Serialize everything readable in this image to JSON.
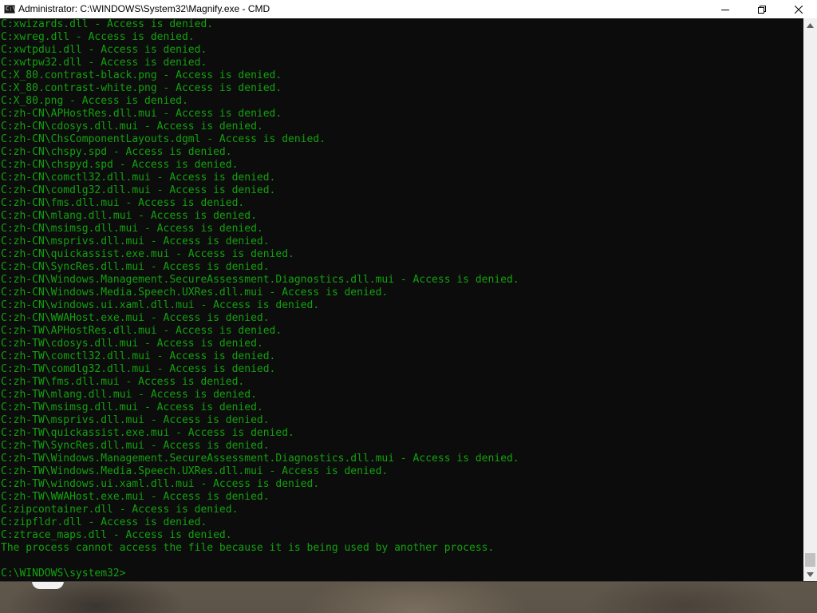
{
  "window": {
    "title": "Administrator: C:\\WINDOWS\\System32\\Magnify.exe - CMD",
    "icon": "cmd-icon",
    "icon_text": "C:\\",
    "controls": {
      "minimize": "minimize-icon",
      "maximize": "maximize-icon",
      "close": "close-icon"
    }
  },
  "console": {
    "text_color": "#13a10e",
    "background": "#0c0c0c",
    "lines": [
      "C:xwizards.dll - Access is denied.",
      "C:xwreg.dll - Access is denied.",
      "C:xwtpdui.dll - Access is denied.",
      "C:xwtpw32.dll - Access is denied.",
      "C:X_80.contrast-black.png - Access is denied.",
      "C:X_80.contrast-white.png - Access is denied.",
      "C:X_80.png - Access is denied.",
      "C:zh-CN\\APHostRes.dll.mui - Access is denied.",
      "C:zh-CN\\cdosys.dll.mui - Access is denied.",
      "C:zh-CN\\ChsComponentLayouts.dgml - Access is denied.",
      "C:zh-CN\\chspy.spd - Access is denied.",
      "C:zh-CN\\chspyd.spd - Access is denied.",
      "C:zh-CN\\comctl32.dll.mui - Access is denied.",
      "C:zh-CN\\comdlg32.dll.mui - Access is denied.",
      "C:zh-CN\\fms.dll.mui - Access is denied.",
      "C:zh-CN\\mlang.dll.mui - Access is denied.",
      "C:zh-CN\\msimsg.dll.mui - Access is denied.",
      "C:zh-CN\\msprivs.dll.mui - Access is denied.",
      "C:zh-CN\\quickassist.exe.mui - Access is denied.",
      "C:zh-CN\\SyncRes.dll.mui - Access is denied.",
      "C:zh-CN\\Windows.Management.SecureAssessment.Diagnostics.dll.mui - Access is denied.",
      "C:zh-CN\\Windows.Media.Speech.UXRes.dll.mui - Access is denied.",
      "C:zh-CN\\windows.ui.xaml.dll.mui - Access is denied.",
      "C:zh-CN\\WWAHost.exe.mui - Access is denied.",
      "C:zh-TW\\APHostRes.dll.mui - Access is denied.",
      "C:zh-TW\\cdosys.dll.mui - Access is denied.",
      "C:zh-TW\\comctl32.dll.mui - Access is denied.",
      "C:zh-TW\\comdlg32.dll.mui - Access is denied.",
      "C:zh-TW\\fms.dll.mui - Access is denied.",
      "C:zh-TW\\mlang.dll.mui - Access is denied.",
      "C:zh-TW\\msimsg.dll.mui - Access is denied.",
      "C:zh-TW\\msprivs.dll.mui - Access is denied.",
      "C:zh-TW\\quickassist.exe.mui - Access is denied.",
      "C:zh-TW\\SyncRes.dll.mui - Access is denied.",
      "C:zh-TW\\Windows.Management.SecureAssessment.Diagnostics.dll.mui - Access is denied.",
      "C:zh-TW\\Windows.Media.Speech.UXRes.dll.mui - Access is denied.",
      "C:zh-TW\\windows.ui.xaml.dll.mui - Access is denied.",
      "C:zh-TW\\WWAHost.exe.mui - Access is denied.",
      "C:zipcontainer.dll - Access is denied.",
      "C:zipfldr.dll - Access is denied.",
      "C:ztrace_maps.dll - Access is denied.",
      "The process cannot access the file because it is being used by another process.",
      ""
    ],
    "prompt": "C:\\WINDOWS\\system32>"
  },
  "scrollbar": {
    "up": "scroll-up-arrow-icon",
    "down": "scroll-down-arrow-icon"
  }
}
